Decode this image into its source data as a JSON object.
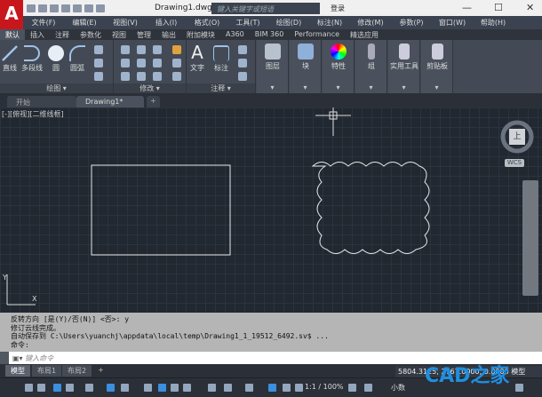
{
  "app": {
    "logo": "A",
    "title": "Drawing1.dwg",
    "search_placeholder": "键入关键字或短语",
    "login": "登录"
  },
  "menu": [
    "文件(F)",
    "编辑(E)",
    "视图(V)",
    "插入(I)",
    "格式(O)",
    "工具(T)",
    "绘图(D)",
    "标注(N)",
    "修改(M)",
    "参数(P)",
    "窗口(W)",
    "帮助(H)"
  ],
  "ribbon_tabs": [
    "默认",
    "插入",
    "注释",
    "参数化",
    "视图",
    "管理",
    "输出",
    "附加模块",
    "A360",
    "BIM 360",
    "Performance",
    "精选应用"
  ],
  "ribbon": {
    "draw": {
      "label": "绘图 ▾",
      "buttons": [
        "直线",
        "多段线",
        "圆",
        "圆弧"
      ]
    },
    "modify": {
      "label": "修改 ▾"
    },
    "annotation": {
      "label": "注释 ▾",
      "buttons": [
        "文字",
        "标注"
      ]
    },
    "panels": [
      "图层",
      "块",
      "特性",
      "组",
      "实用工具",
      "剪贴板"
    ]
  },
  "doc_tabs": [
    "开始",
    "Drawing1*"
  ],
  "viewport": {
    "label": "[-][俯视][二维线框]",
    "viewcube_face": "上",
    "wcs": "WCS"
  },
  "command": {
    "history": [
      "反转方向 [是(Y)/否(N)] <否>: y",
      "修订云线完成。",
      "自动保存到 C:\\Users\\yuanchj\\appdata\\local\\temp\\Drawing1_1_19512_6492.sv$ ...",
      "命令:"
    ],
    "placeholder": "键入命令"
  },
  "layout_tabs": [
    "模型",
    "布局1",
    "布局2"
  ],
  "status": {
    "coords": "5804.3125, 2767.0000, 0.0000",
    "model": "模型",
    "scale": "1:1 / 100%",
    "units": "小数"
  },
  "watermark": "CAD之家"
}
